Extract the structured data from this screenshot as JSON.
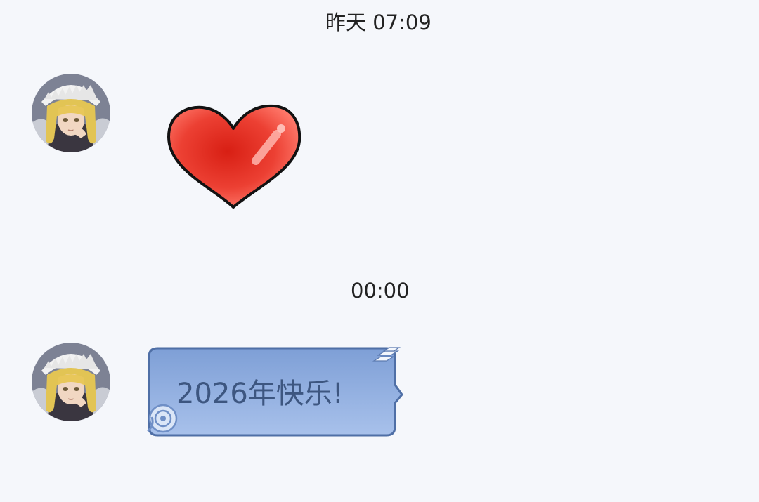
{
  "conversation": {
    "messages": [
      {
        "timestamp": "昨天 07:09",
        "type": "sticker",
        "sticker": "red-heart-icon"
      },
      {
        "timestamp": "00:00",
        "type": "text",
        "text": "2026年快乐!"
      }
    ]
  },
  "colors": {
    "background": "#f5f7fb",
    "bubble_fill": "#8aa9dc",
    "bubble_border": "#4f6fa6",
    "bubble_text": "#3d5680",
    "heart_red": "#e8342b"
  }
}
